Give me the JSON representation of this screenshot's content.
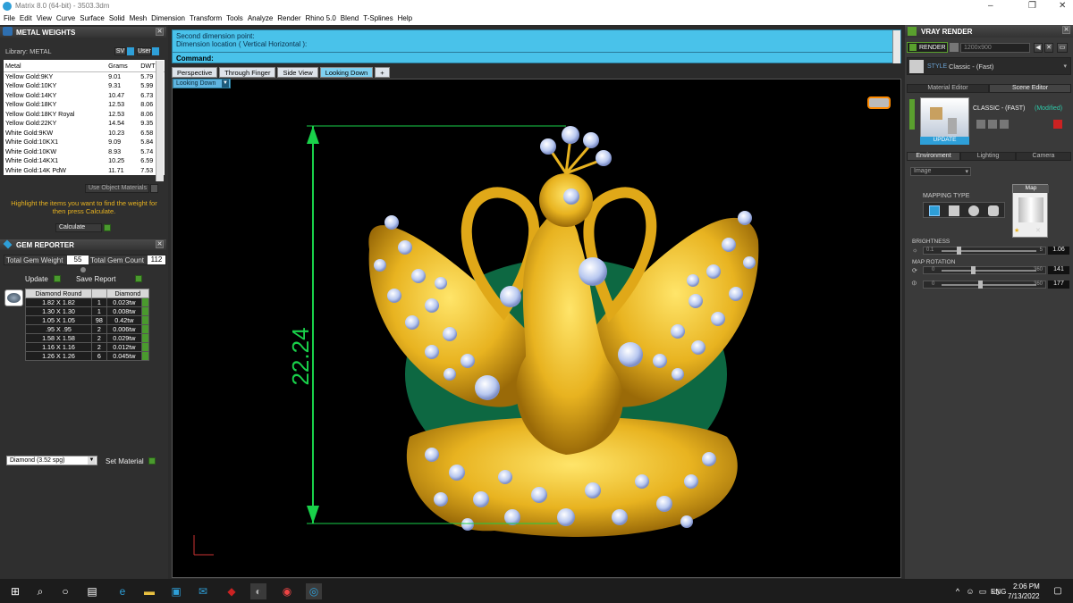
{
  "app": {
    "title": "Matrix 8.0 (64-bit) - 3503.3dm"
  },
  "window_controls": {
    "minimize": "–",
    "maximize": "❐",
    "close": "✕"
  },
  "menu": [
    "File",
    "Edit",
    "View",
    "Curve",
    "Surface",
    "Solid",
    "Mesh",
    "Dimension",
    "Transform",
    "Tools",
    "Analyze",
    "Render",
    "Rhino 5.0",
    "Blend",
    "T-Splines",
    "Help"
  ],
  "metal_weights": {
    "title": "METAL WEIGHTS",
    "library_label": "Library: METAL",
    "sv_label": "SV",
    "user_label": "User",
    "columns": [
      "Metal",
      "Grams",
      "DWT"
    ],
    "rows": [
      [
        "Yellow Gold:9KY",
        "9.01",
        "5.79"
      ],
      [
        "Yellow Gold:10KY",
        "9.31",
        "5.99"
      ],
      [
        "Yellow Gold:14KY",
        "10.47",
        "6.73"
      ],
      [
        "Yellow Gold:18KY",
        "12.53",
        "8.06"
      ],
      [
        "Yellow Gold:18KY Royal",
        "12.53",
        "8.06"
      ],
      [
        "Yellow Gold:22KY",
        "14.54",
        "9.35"
      ],
      [
        "White Gold:9KW",
        "10.23",
        "6.58"
      ],
      [
        "White Gold:10KX1",
        "9.09",
        "5.84"
      ],
      [
        "White Gold:10KW",
        "8.93",
        "5.74"
      ],
      [
        "White Gold:14KX1",
        "10.25",
        "6.59"
      ],
      [
        "White Gold:14K PdW",
        "11.71",
        "7.53"
      ]
    ],
    "use_object_materials": "Use Object Materials",
    "hint": "Highlight the items you want to find the weight for then press Calculate.",
    "calculate_label": "Calculate"
  },
  "gem_reporter": {
    "title": "GEM REPORTER",
    "total_weight_label": "Total Gem Weight",
    "total_weight_value": "55",
    "total_count_label": "Total Gem Count",
    "total_count_value": "112",
    "update_label": "Update",
    "save_report_label": "Save Report",
    "columns": [
      "Diamond Round",
      "",
      "Diamond"
    ],
    "rows": [
      [
        "1.82 X 1.82",
        "1",
        "0.023tw"
      ],
      [
        "1.30 X 1.30",
        "1",
        "0.008tw"
      ],
      [
        "1.05 X 1.05",
        "98",
        "0.42tw"
      ],
      [
        ".95 X .95",
        "2",
        "0.006tw"
      ],
      [
        "1.58 X 1.58",
        "2",
        "0.029tw"
      ],
      [
        "1.16 X 1.16",
        "2",
        "0.012tw"
      ],
      [
        "1.26 X 1.26",
        "6",
        "0.045tw"
      ]
    ],
    "material_select": "Diamond     (3.52 spg)",
    "set_material_label": "Set Material"
  },
  "command": {
    "line1": "Second dimension point:",
    "line2": "Dimension location ( Vertical  Horizontal ):",
    "prompt": "Command:"
  },
  "view_tabs": [
    "Perspective",
    "Through Finger",
    "Side View",
    "Looking Down"
  ],
  "add_tab": "+",
  "active_view": "Looking Down",
  "viewport": {
    "dimension_value": "22.24"
  },
  "vray": {
    "title": "VRAY RENDER",
    "render_label": "RENDER",
    "resolution": "1200x900",
    "style_label": "STYLE",
    "style_value": "Classic - (Fast)",
    "tabs": [
      "Material Editor",
      "Scene Editor"
    ],
    "scene_name": "CLASSIC - (FAST)",
    "modified": "(Modified)",
    "update_label": "UPDATE",
    "env_tabs": [
      "Environment",
      "Lighting",
      "Camera"
    ],
    "image_select": "Image",
    "map_label": "Map",
    "mapping_type_label": "MAPPING TYPE",
    "brightness_label": "BRIGHTNESS",
    "brightness_min": "0.1",
    "brightness_max": "5",
    "brightness_value": "1.06",
    "map_rotation_label": "MAP ROTATION",
    "rot1_min": "0",
    "rot1_max": "360",
    "rot1_value": "141",
    "rot2_min": "0",
    "rot2_max": "360",
    "rot2_value": "177"
  },
  "taskbar": {
    "lang": "ENG",
    "time": "2:06 PM",
    "date": "7/13/2022"
  },
  "colors": {
    "accent": "#49c2ea",
    "dimension": "#19d14a",
    "gold": "#e8b320",
    "green_button": "#4a9a2e"
  }
}
